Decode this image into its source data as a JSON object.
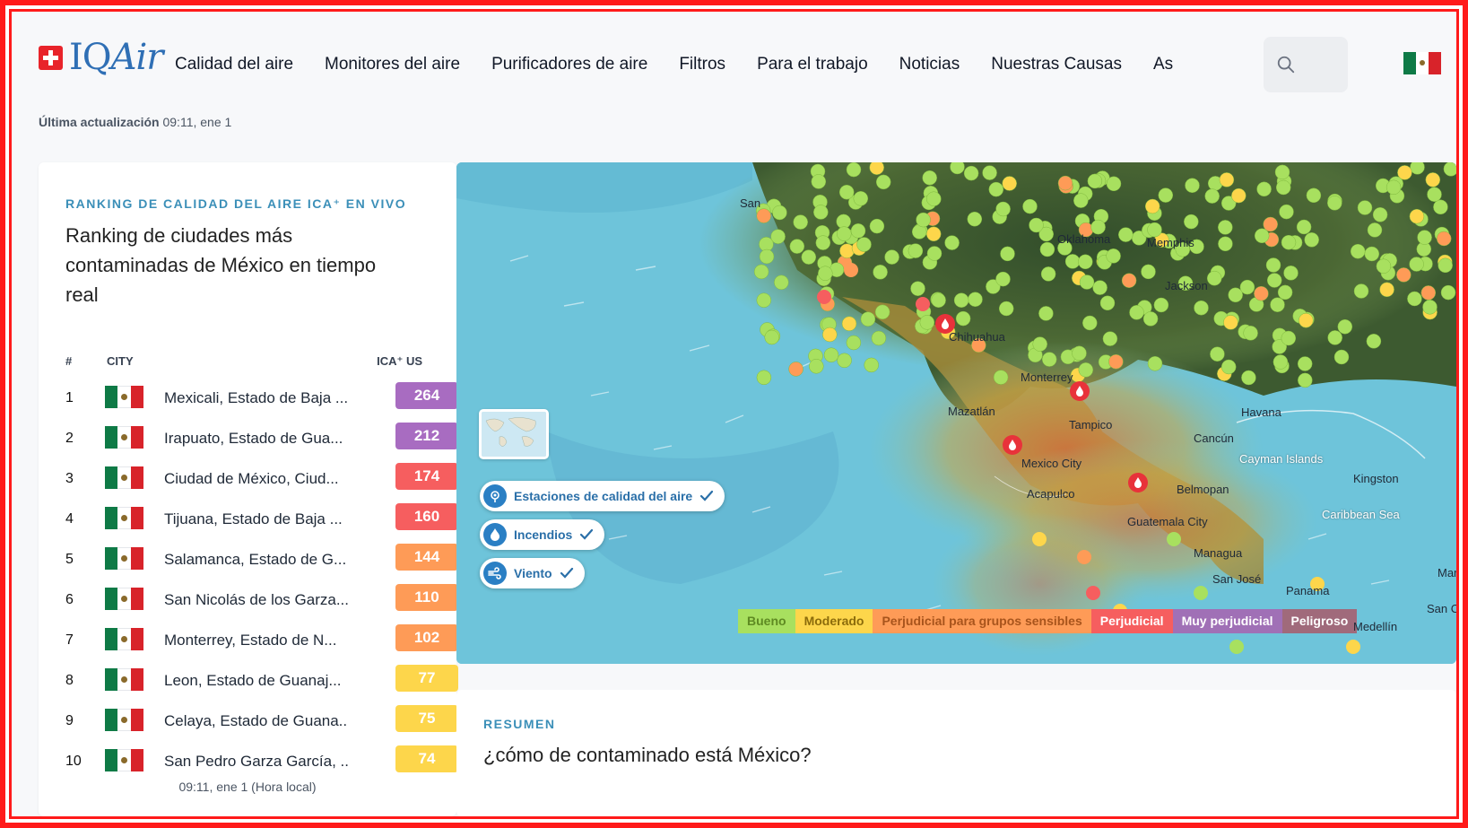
{
  "brand": {
    "name_prefix": "IQ",
    "name_suffix": "Air"
  },
  "nav": {
    "items": [
      "Calidad del aire",
      "Monitores del aire",
      "Purificadores de aire",
      "Filtros",
      "Para el trabajo",
      "Noticias",
      "Nuestras Causas",
      "As"
    ]
  },
  "header": {
    "search_icon": "search-icon",
    "flag_icon": "mexico-flag-icon"
  },
  "updated": {
    "label": "Última actualización",
    "value": "09:11, ene 1"
  },
  "ranking": {
    "eyebrow": "RANKING DE CALIDAD DEL AIRE ICA⁺ EN VIVO",
    "title": "Ranking de ciudades más contaminadas de México en tiempo real",
    "col_num": "#",
    "col_city": "CITY",
    "col_aqi": "ICA⁺ US",
    "rows": [
      {
        "rank": "1",
        "city": "Mexicali, Estado de Baja ...",
        "aqi": "264",
        "color": "#a86cc1"
      },
      {
        "rank": "2",
        "city": "Irapuato, Estado de Gua...",
        "aqi": "212",
        "color": "#a86cc1"
      },
      {
        "rank": "3",
        "city": "Ciudad de México, Ciud...",
        "aqi": "174",
        "color": "#f65e5f"
      },
      {
        "rank": "4",
        "city": "Tijuana, Estado de Baja ...",
        "aqi": "160",
        "color": "#f65e5f"
      },
      {
        "rank": "5",
        "city": "Salamanca, Estado de G...",
        "aqi": "144",
        "color": "#fe9b57"
      },
      {
        "rank": "6",
        "city": "San Nicolás de los Garza...",
        "aqi": "110",
        "color": "#fe9b57"
      },
      {
        "rank": "7",
        "city": "Monterrey, Estado de N...",
        "aqi": "102",
        "color": "#fe9b57"
      },
      {
        "rank": "8",
        "city": "Leon, Estado de Guanaj...",
        "aqi": "77",
        "color": "#fdd64b"
      },
      {
        "rank": "9",
        "city": "Celaya, Estado de Guana...",
        "aqi": "75",
        "color": "#fdd64b"
      },
      {
        "rank": "10",
        "city": "San Pedro Garza García, ...",
        "aqi": "74",
        "color": "#fdd64b"
      }
    ],
    "footer": "09:11, ene 1 (Hora local)"
  },
  "map": {
    "toggles": [
      {
        "label": "Estaciones de calidad del aire",
        "icon": "station-icon"
      },
      {
        "label": "Incendios",
        "icon": "fire-icon"
      },
      {
        "label": "Viento",
        "icon": "wind-icon"
      }
    ],
    "legend": [
      {
        "label": "Bueno",
        "color": "#a8e05f",
        "text": "#5e8a22"
      },
      {
        "label": "Moderado",
        "color": "#fdd64b",
        "text": "#8c6c0b"
      },
      {
        "label": "Perjudicial para grupos sensibles",
        "color": "#fe9b57",
        "text": "#a8541c"
      },
      {
        "label": "Perjudicial",
        "color": "#f65e5f",
        "text": "#ffffff"
      },
      {
        "label": "Muy perjudicial",
        "color": "#a070b6",
        "text": "#ffffff"
      },
      {
        "label": "Peligroso",
        "color": "#a06a7b",
        "text": "#ffffff"
      }
    ],
    "places": [
      "San",
      "Oklahoma",
      "Chihuahua",
      "Mazatlán",
      "Monterrey",
      "Tampico",
      "Havana",
      "Cancún",
      "Cayman Islands",
      "Acapulco",
      "Belmopan",
      "Guatemala City",
      "Managua",
      "San José",
      "Panama",
      "Caribbean Sea",
      "Medellín",
      "San Cr",
      "Mar",
      "Memphis",
      "Jackson",
      "Mexico City",
      "Kingston"
    ]
  },
  "summary": {
    "eyebrow": "RESUMEN",
    "title": "¿cómo de contaminado está México?"
  }
}
